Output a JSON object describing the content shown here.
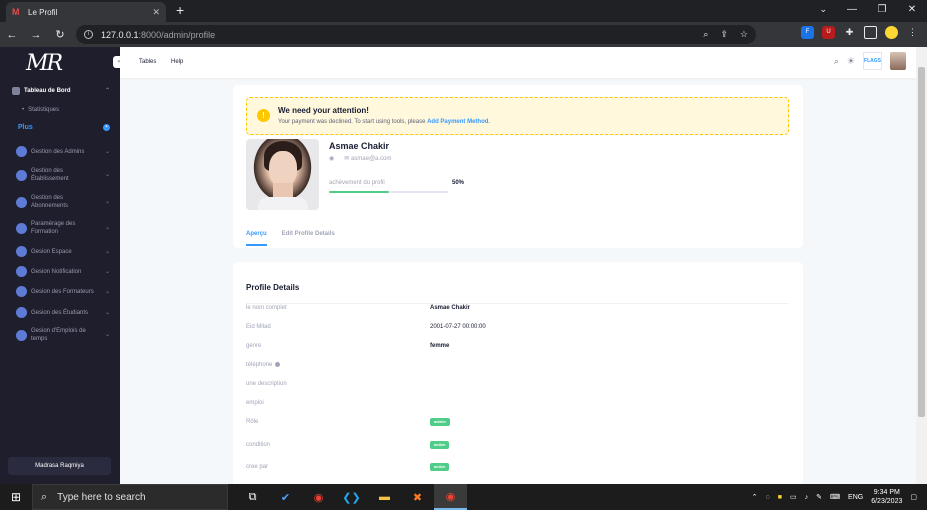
{
  "browser": {
    "tab_title": "Le Profil",
    "favicon": "M",
    "url_host": "127.0.0.1",
    "url_path": ":8000/admin/profile"
  },
  "sidebar": {
    "logo": "MR",
    "items": [
      {
        "label": "Tableau de Bord",
        "icon": "dashboard-icon"
      },
      {
        "label": "Statistiques"
      },
      {
        "label": "Plus"
      },
      {
        "label": "Gestion des Admins",
        "icon": "admins-icon"
      },
      {
        "label": "Gestion des Établissement",
        "icon": "establishment-icon"
      },
      {
        "label": "Gestion des Abonnements",
        "icon": "subscriptions-icon"
      },
      {
        "label": "Paramérage des Formation",
        "icon": "training-settings-icon"
      },
      {
        "label": "Gesion Espace",
        "icon": "space-icon"
      },
      {
        "label": "Gesion Notification",
        "icon": "notification-icon"
      },
      {
        "label": "Gesion des Formateurs",
        "icon": "trainers-icon"
      },
      {
        "label": "Gesion des Étudiants",
        "icon": "students-icon"
      },
      {
        "label": "Gesion d'Emplois de temps",
        "icon": "timetable-icon"
      }
    ],
    "footer_label": "Madrasa Raqmiya"
  },
  "header": {
    "links": [
      "Tables",
      "Help"
    ],
    "flag_label": "FLAGS"
  },
  "alert": {
    "title": "We need your attention!",
    "text": "Your payment was declined. To start using tools, please ",
    "link": "Add Payment Method."
  },
  "profile": {
    "name": "Asmae Chakir",
    "email": "asmae@a.com",
    "progress_label": "achèvement du profil",
    "progress_value": 0.5,
    "progress_pct": "50%"
  },
  "tabs": [
    {
      "label": "Aperçu",
      "active": true
    },
    {
      "label": "Edit Profile Details",
      "active": false
    }
  ],
  "details": {
    "title": "Profile Details",
    "rows": [
      {
        "label": "le nom complet",
        "value": "Asmae Chakir",
        "bold": true
      },
      {
        "label": "Eid Milad",
        "value": "2001-07-27 00:00:00",
        "bold": false
      },
      {
        "label": "genre",
        "value": "femme",
        "bold": true
      },
      {
        "label": "téléphone",
        "value": "",
        "info": true
      },
      {
        "label": "une description",
        "value": ""
      },
      {
        "label": "emploi",
        "value": ""
      },
      {
        "label": "Rôle",
        "badge": "admin"
      },
      {
        "label": "condition",
        "badge": "active"
      },
      {
        "label": "cree par",
        "badge": "active"
      }
    ]
  },
  "taskbar": {
    "search_placeholder": "Type here to search",
    "lang": "ENG",
    "time": "9:34 PM",
    "date": "6/23/2023"
  },
  "colors": {
    "sidebar_bg": "#1e1e2d",
    "accent": "#3699ff",
    "success": "#50cd89",
    "warning_bg": "#fff8dd",
    "warning_border": "#ffc700"
  }
}
